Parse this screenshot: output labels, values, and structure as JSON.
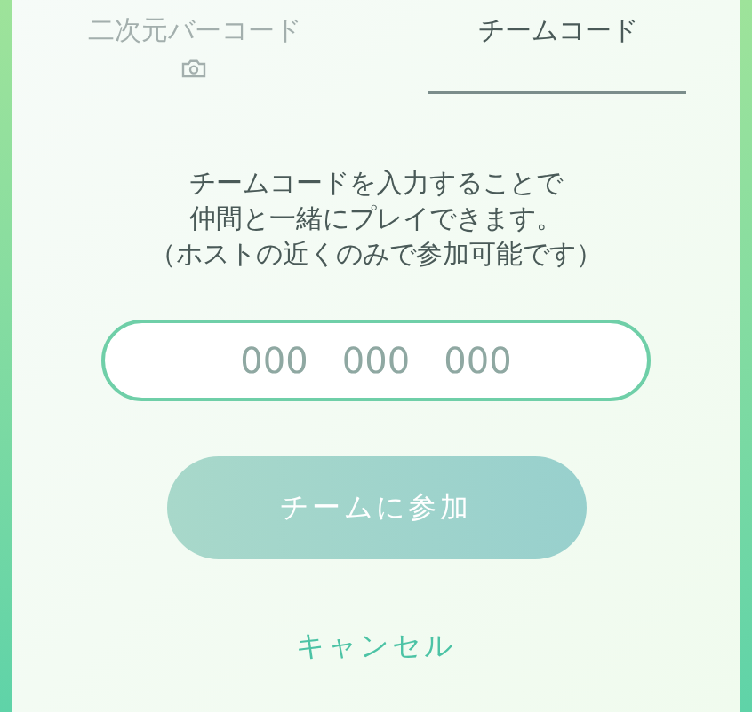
{
  "tabs": [
    {
      "label": "二次元バーコード",
      "kind": "scan",
      "selected": false
    },
    {
      "label": "チームコード",
      "kind": "code",
      "selected": true
    }
  ],
  "instructions": [
    "チームコードを入力することで",
    "仲間と一緒にプレイできます。",
    "（ホストの近くのみで参加可能です）"
  ],
  "code_field": {
    "placeholder": "000   000   000"
  },
  "join_button": {
    "label": "チームに参加",
    "disabled": true
  },
  "cancel_link": "キャンセル"
}
